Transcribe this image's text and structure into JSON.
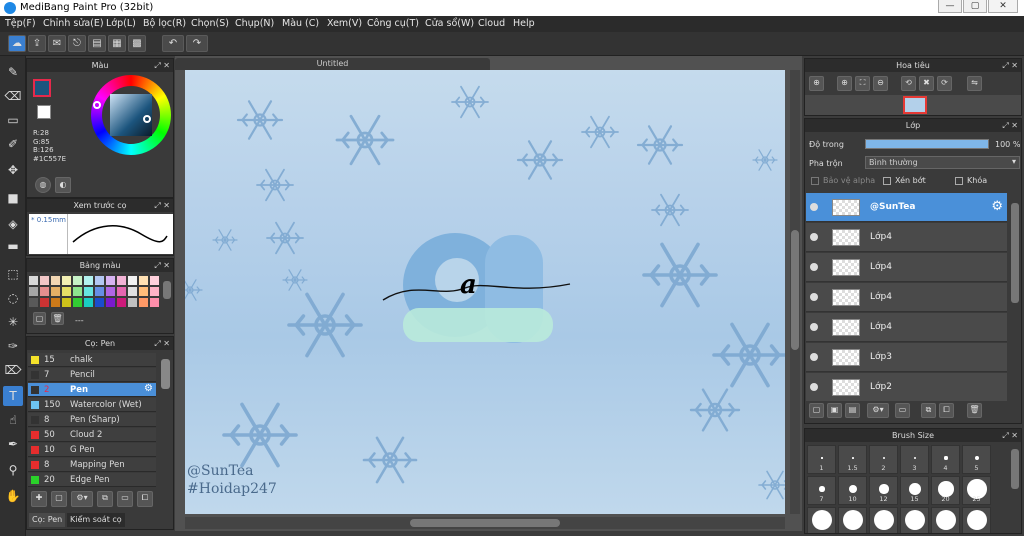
{
  "window": {
    "title": "MediBang Paint Pro (32bit)",
    "min": "—",
    "max": "▢",
    "close": "✕"
  },
  "menu": [
    "Tệp(F)",
    "Chỉnh sửa(E)",
    "Lớp(L)",
    "Bộ lọc(R)",
    "Chọn(S)",
    "Chụp(N)",
    "Màu (C)",
    "Xem(V)",
    "Công cụ(T)",
    "Cửa sổ(W)",
    "Cloud",
    "Help"
  ],
  "document": {
    "tab": "Untitled",
    "watermark1": "@SunTea",
    "watermark2": "#Hoidap247",
    "letter": "a"
  },
  "color_panel": {
    "title": "Màu",
    "r": "R:28",
    "g": "G:85",
    "b": "B:126",
    "hex": "#1C557E",
    "primary_color": "#1C557E",
    "secondary_color": "#ffffff",
    "accent": "#e6294b"
  },
  "brush_preview": {
    "title": "Xem trước cọ",
    "size": "0.15mm"
  },
  "palette": {
    "title": "Bảng màu",
    "label": "---",
    "colors": [
      "#d9d9d9",
      "#f2c7c7",
      "#f2d6b3",
      "#f2efb3",
      "#c7f2c7",
      "#b3f2ef",
      "#b3c7f2",
      "#d6b3f2",
      "#f2b3d6",
      "#f2f2f2",
      "#ffe0b3",
      "#ffd1dc",
      "#a6a6a6",
      "#e58e8e",
      "#e5b066",
      "#e5df66",
      "#8ee58e",
      "#66e5df",
      "#668ee5",
      "#b066e5",
      "#e566b0",
      "#e0e0e0",
      "#ffbd7a",
      "#ffb3c6",
      "#595959",
      "#cc3333",
      "#cc7a1a",
      "#ccc21a",
      "#33cc33",
      "#1accc2",
      "#1a4dcc",
      "#7a1acc",
      "#cc1a7a",
      "#c0c0c0",
      "#ff9966",
      "#ff8fab"
    ]
  },
  "brushes": {
    "title": "Cọ: Pen",
    "list": [
      {
        "size": "15",
        "name": "chalk",
        "color": "#f5e22a"
      },
      {
        "size": "7",
        "name": "Pencil",
        "color": "#333333"
      },
      {
        "size": "2",
        "name": "Pen",
        "color": "#333333"
      },
      {
        "size": "150",
        "name": "Watercolor (Wet)",
        "color": "#6ec3f0"
      },
      {
        "size": "8",
        "name": "Pen (Sharp)",
        "color": "#333333"
      },
      {
        "size": "50",
        "name": "Cloud 2",
        "color": "#e52d2d"
      },
      {
        "size": "10",
        "name": "G Pen",
        "color": "#e52d2d"
      },
      {
        "size": "8",
        "name": "Mapping Pen",
        "color": "#e52d2d"
      },
      {
        "size": "20",
        "name": "Edge Pen",
        "color": "#2ad12a"
      }
    ],
    "selected_index": 2,
    "tab1": "Cọ: Pen",
    "tab2": "Kiểm soát cọ"
  },
  "navigator": {
    "title": "Hoa tiêu"
  },
  "layers": {
    "title": "Lớp",
    "opacity_label": "Độ trong",
    "opacity_value": "100 %",
    "opacity_fraction": 1.0,
    "blend_label": "Pha trộn",
    "blend_value": "Bình thường",
    "protect_alpha": "Bảo vệ alpha",
    "clipping": "Xén bớt",
    "lock": "Khóa",
    "list": [
      {
        "name": "@SunTea"
      },
      {
        "name": "Lớp4"
      },
      {
        "name": "Lớp4"
      },
      {
        "name": "Lớp4"
      },
      {
        "name": "Lớp4"
      },
      {
        "name": "Lớp3"
      },
      {
        "name": "Lớp2"
      }
    ],
    "selected_index": 0
  },
  "brush_size": {
    "title": "Brush Size",
    "sizes": [
      "1",
      "1.5",
      "2",
      "3",
      "4",
      "5",
      "7",
      "10",
      "12",
      "15",
      "20",
      "25"
    ]
  }
}
